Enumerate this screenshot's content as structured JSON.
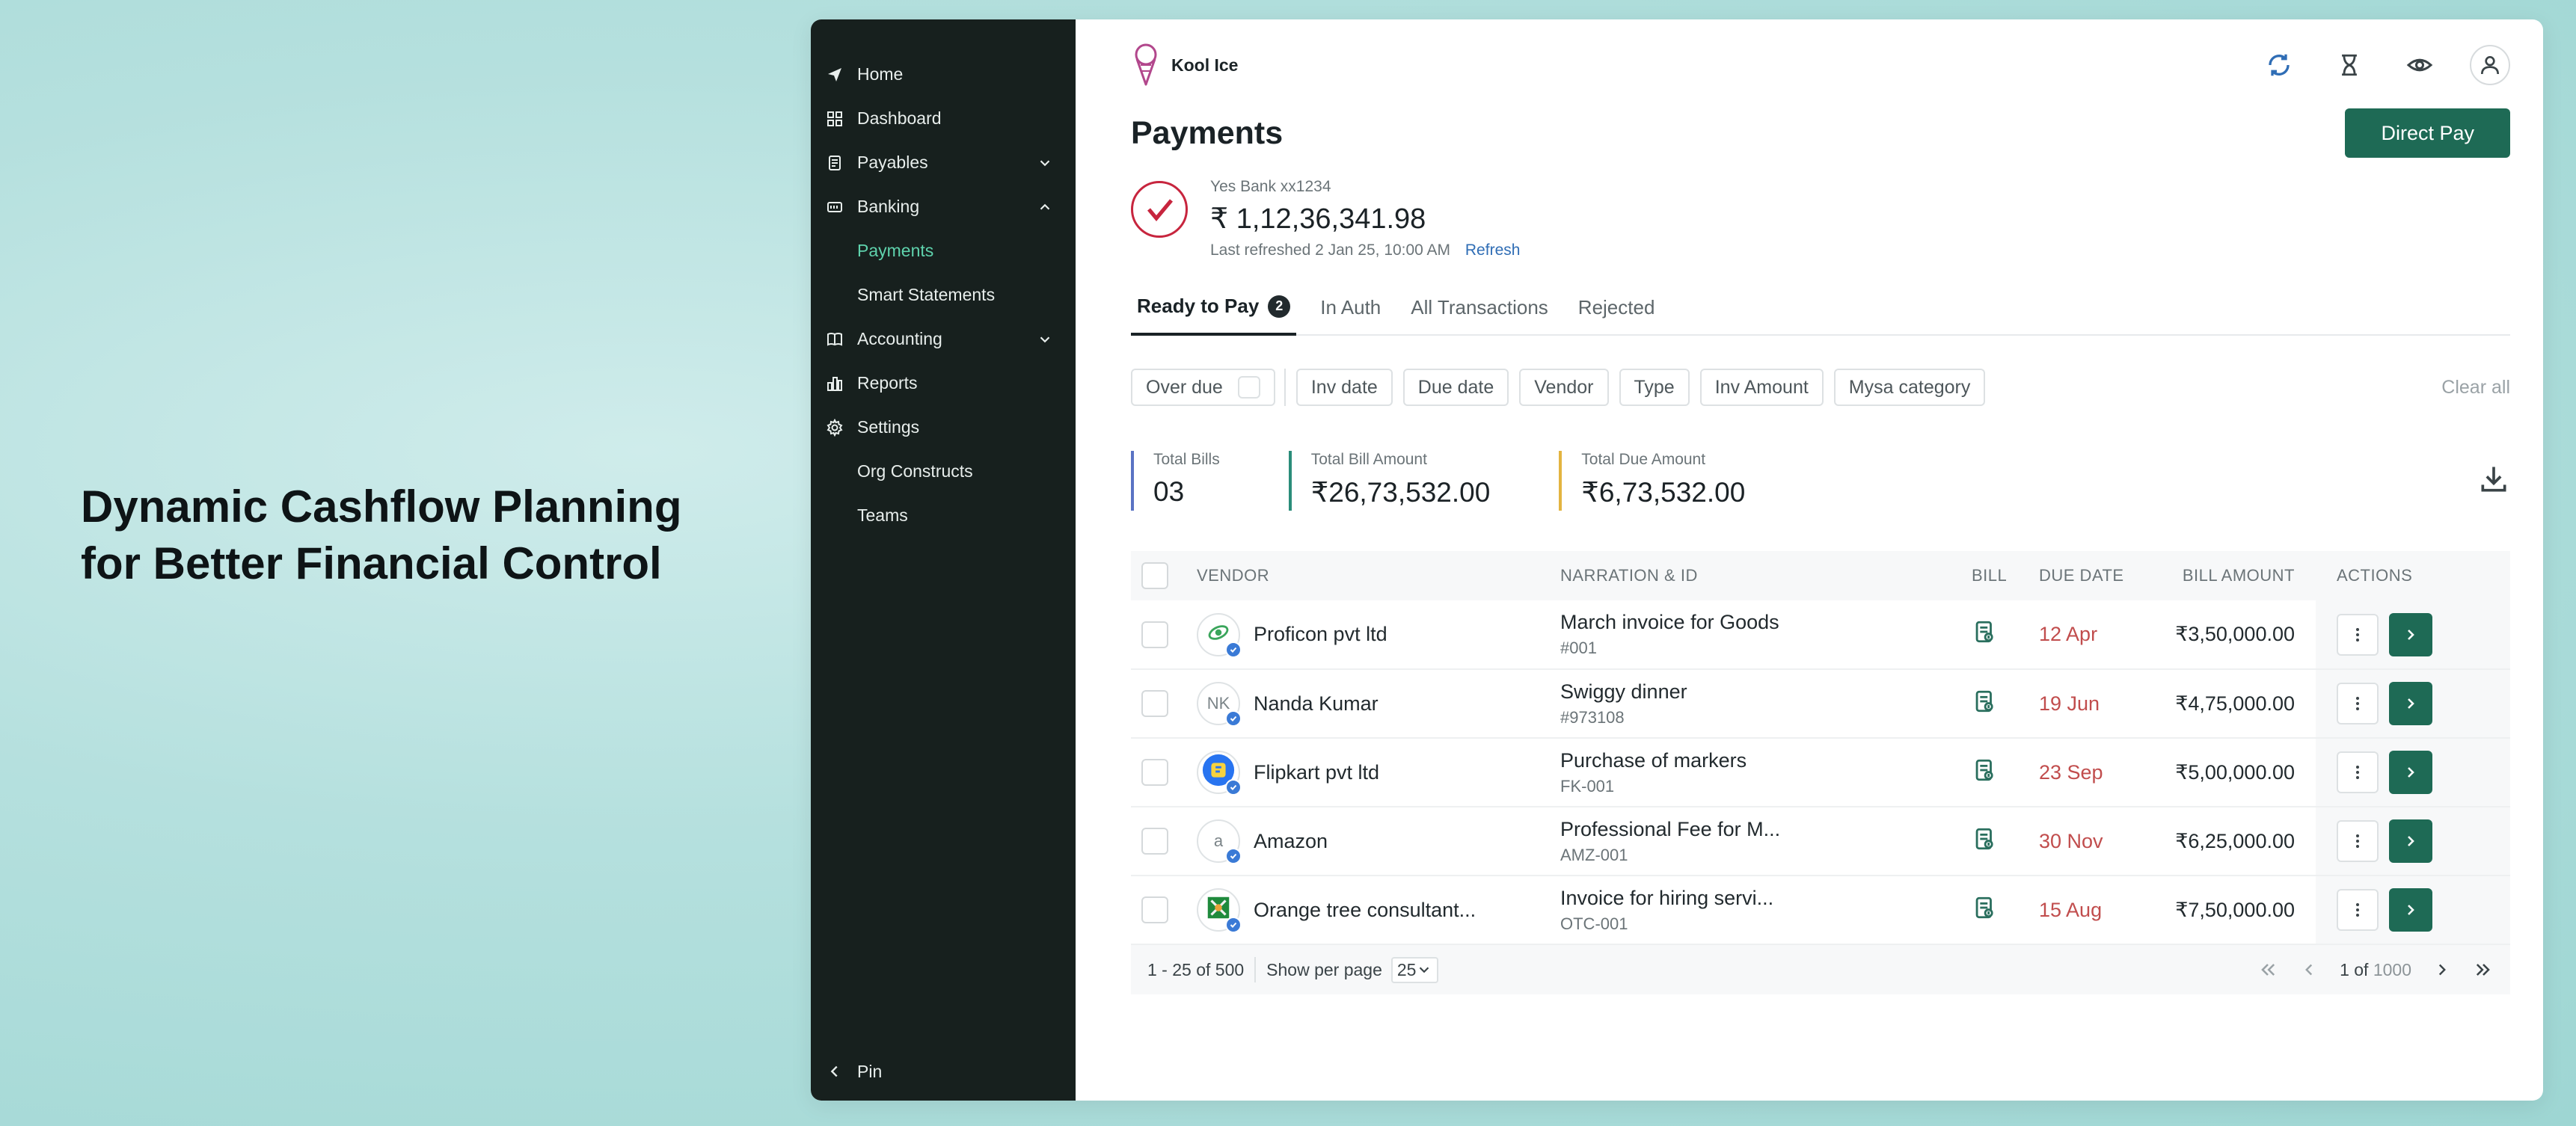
{
  "headline": {
    "line1": "Dynamic Cashflow Planning",
    "line2": "for Better Financial Control"
  },
  "sidebar": {
    "items": [
      {
        "label": "Home",
        "icon": "send-icon"
      },
      {
        "label": "Dashboard",
        "icon": "grid-icon"
      },
      {
        "label": "Payables",
        "icon": "document-icon",
        "expanded": false
      },
      {
        "label": "Banking",
        "icon": "bank-icon",
        "expanded": true
      },
      {
        "label": "Payments",
        "sub": true,
        "active": true
      },
      {
        "label": "Smart Statements",
        "sub": true
      },
      {
        "label": "Accounting",
        "icon": "book-icon",
        "expanded": false
      },
      {
        "label": "Reports",
        "icon": "chart-icon"
      },
      {
        "label": "Settings",
        "icon": "gear-icon"
      },
      {
        "label": "Org Constructs",
        "sub": true
      },
      {
        "label": "Teams",
        "sub": true
      }
    ],
    "pin_label": "Pin",
    "active_color": "#5fd3ad"
  },
  "brand": {
    "name": "Kool Ice"
  },
  "page": {
    "title": "Payments",
    "primary_action": "Direct Pay"
  },
  "bank": {
    "name": "Yes Bank xx1234",
    "balance": "₹ 1,12,36,341.98",
    "last_refreshed": "Last refreshed 2 Jan 25, 10:00 AM",
    "refresh_label": "Refresh"
  },
  "tabs": [
    {
      "label": "Ready to Pay",
      "count": "2",
      "active": true
    },
    {
      "label": "In Auth"
    },
    {
      "label": "All Transactions"
    },
    {
      "label": "Rejected"
    }
  ],
  "filters": {
    "overdue": "Over due",
    "chips": [
      "Inv date",
      "Due date",
      "Vendor",
      "Type",
      "Inv Amount",
      "Mysa category"
    ],
    "clear_all": "Clear all"
  },
  "stats": [
    {
      "label": "Total Bills",
      "value": "03"
    },
    {
      "label": "Total Bill Amount",
      "value": "₹26,73,532.00"
    },
    {
      "label": "Total Due Amount",
      "value": "₹6,73,532.00"
    }
  ],
  "table": {
    "headers": {
      "vendor": "VENDOR",
      "narration": "NARRATION & ID",
      "bill": "BILL",
      "due_date": "DUE DATE",
      "amount": "BILL AMOUNT",
      "actions": "ACTIONS"
    },
    "rows": [
      {
        "vendor": "Proficon pvt ltd",
        "avatar": "leaf-logo",
        "narration": "March invoice for Goods",
        "id": "#001",
        "due": "12 Apr",
        "amount": "₹3,50,000.00"
      },
      {
        "vendor": "Nanda Kumar",
        "avatar_text": "NK",
        "narration": "Swiggy dinner",
        "id": "#973108",
        "due": "19 Jun",
        "amount": "₹4,75,000.00"
      },
      {
        "vendor": "Flipkart pvt ltd",
        "avatar": "flipkart-logo",
        "narration": "Purchase of markers",
        "id": "FK-001",
        "due": "23 Sep",
        "amount": "₹5,00,000.00"
      },
      {
        "vendor": "Amazon",
        "avatar_text": "a",
        "narration": "Professional Fee for M...",
        "id": "AMZ-001",
        "due": "30 Nov",
        "amount": "₹6,25,000.00"
      },
      {
        "vendor": "Orange tree consultant...",
        "avatar": "tree-logo",
        "narration": "Invoice for hiring servi...",
        "id": "OTC-001",
        "due": "15 Aug",
        "amount": "₹7,50,000.00"
      }
    ]
  },
  "pager": {
    "range": "1 - 25 of 500",
    "per_page_label": "Show per page",
    "per_page": "25",
    "page": "1 of",
    "total_pages": "1000"
  },
  "colors": {
    "primary": "#1e6a55",
    "due": "#c14d4d",
    "link": "#2f6db5",
    "sidebar_bg": "#17201e"
  }
}
